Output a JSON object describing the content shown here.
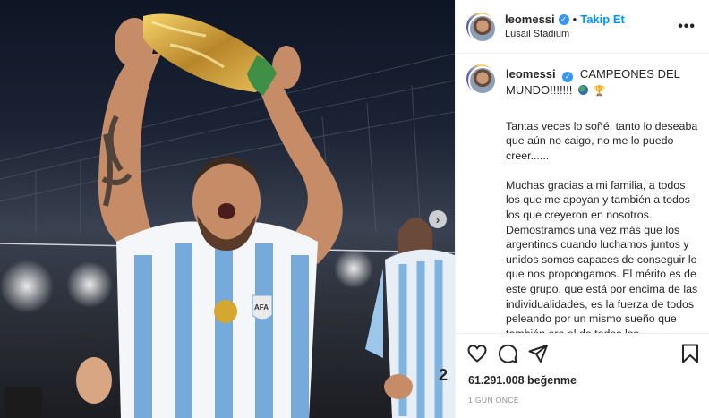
{
  "post": {
    "username": "leomessi",
    "follow_label": "Takip Et",
    "location": "Lusail Stadium",
    "dot": "•",
    "more_label": "•••"
  },
  "caption": {
    "username": "leomessi",
    "headline": "CAMPEONES DEL MUNDO!!!!!!!",
    "trophy_emoji": "🏆",
    "paragraphs": [
      "Tantas veces lo soñé, tanto lo deseaba que aún no caigo, no me lo puedo creer......",
      "Muchas gracias a mi familia, a todos los que me apoyan y también a todos los que creyeron en nosotros. Demostramos una vez más que los argentinos cuando luchamos juntos y unidos somos capaces de conseguir lo que nos propongamos. El mérito es de este grupo, que está por encima de las individualidades, es la fuerza de todos peleando por un mismo sueño que también era el de todos los argentinos... Lo logramos!!!"
    ]
  },
  "engagement": {
    "likes_count": "61.291.008",
    "likes_word": "beğenme",
    "time_ago": "1 GÜN ÖNCE"
  },
  "photo": {
    "next_arrow": "›"
  },
  "icons": [
    "heart-icon",
    "comment-icon",
    "share-icon",
    "save-icon",
    "verified-badge-icon",
    "globe-emoji",
    "trophy-emoji"
  ],
  "colors": {
    "accent_blue": "#0095f6",
    "verified_blue": "#3897f0",
    "text": "#262626",
    "muted": "#8e8e8e",
    "divider": "#efefef",
    "jersey_blue": "#75aadb"
  }
}
